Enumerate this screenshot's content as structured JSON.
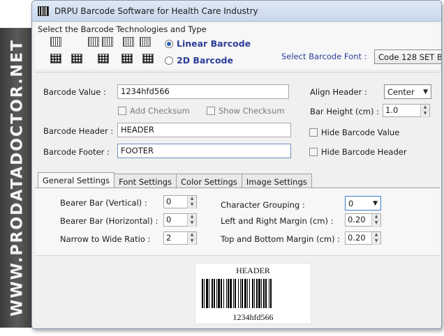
{
  "banner": {
    "text": "WWW.PRODATADOCTOR.NET"
  },
  "window": {
    "title": "DRPU Barcode Software for Health Care Industry"
  },
  "technologies": {
    "label": "Select the Barcode Technologies and Type",
    "linear_label": "Linear Barcode",
    "twod_label": "2D Barcode",
    "selected": "Linear Barcode",
    "font_label": "Select Barcode Font :",
    "font_value": "Code 128 SET B"
  },
  "fields": {
    "value_label": "Barcode Value :",
    "value": "1234hfd566",
    "add_checksum": "Add Checksum",
    "show_checksum": "Show Checksum",
    "header_label": "Barcode Header :",
    "header_value": "HEADER",
    "footer_label": "Barcode Footer :",
    "footer_value": "FOOTER",
    "align_header_label": "Align Header :",
    "align_header_value": "Center",
    "bar_height_label": "Bar Height (cm) :",
    "bar_height_value": "1.0",
    "hide_value": "Hide Barcode Value",
    "hide_header": "Hide Barcode Header"
  },
  "tabs": [
    {
      "label": "General Settings",
      "active": true
    },
    {
      "label": "Font Settings",
      "active": false
    },
    {
      "label": "Color Settings",
      "active": false
    },
    {
      "label": "Image Settings",
      "active": false
    }
  ],
  "general": {
    "bearer_v_label": "Bearer Bar (Vertical) :",
    "bearer_v_value": "0",
    "bearer_h_label": "Bearer Bar (Horizontal) :",
    "bearer_h_value": "0",
    "ratio_label": "Narrow to Wide Ratio :",
    "ratio_value": "2",
    "char_group_label": "Character Grouping :",
    "char_group_value": "0",
    "lr_margin_label": "Left and Right Margin (cm) :",
    "lr_margin_value": "0.20",
    "tb_margin_label": "Top and Bottom Margin (cm) :",
    "tb_margin_value": "0.20"
  },
  "preview": {
    "header": "HEADER",
    "footer": "1234hfd566"
  }
}
